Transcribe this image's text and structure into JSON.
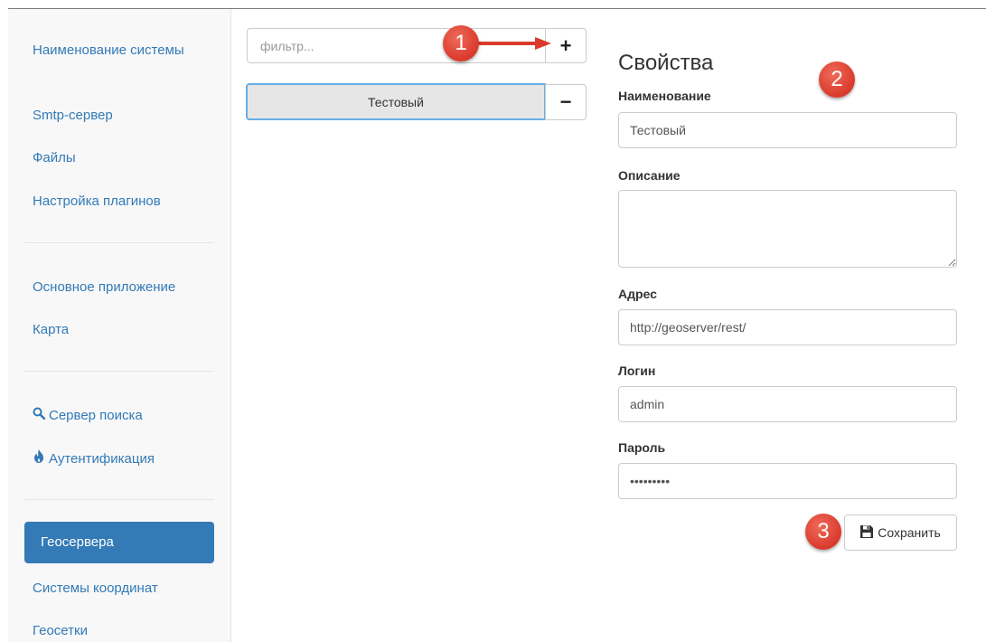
{
  "sidebar": {
    "items": [
      {
        "label": "Наименование системы",
        "icon": "",
        "active": false
      },
      {
        "label": "Smtp-сервер",
        "icon": "",
        "active": false
      },
      {
        "label": "Файлы",
        "icon": "",
        "active": false
      },
      {
        "label": "Настройка плагинов",
        "icon": "",
        "active": false
      },
      {
        "label": "Основное приложение",
        "icon": "",
        "active": false
      },
      {
        "label": "Карта",
        "icon": "",
        "active": false
      },
      {
        "label": "Сервер поиска",
        "icon": "search-icon",
        "active": false
      },
      {
        "label": "Аутентификация",
        "icon": "fire-icon",
        "active": false
      },
      {
        "label": "Геосервера",
        "icon": "",
        "active": true
      },
      {
        "label": "Системы координат",
        "icon": "",
        "active": false
      },
      {
        "label": "Геосетки",
        "icon": "",
        "active": false
      }
    ]
  },
  "list": {
    "filter_placeholder": "фильтр...",
    "add_label": "+",
    "remove_label": "−",
    "items": [
      {
        "label": "Тестовый",
        "selected": true
      }
    ]
  },
  "properties": {
    "title": "Свойства",
    "name_label": "Наименование",
    "name_value": "Тестовый",
    "description_label": "Описание",
    "description_value": "",
    "address_label": "Адрес",
    "address_value": "http://geoserver/rest/",
    "login_label": "Логин",
    "login_value": "admin",
    "password_label": "Пароль",
    "password_value": "secretpwd",
    "save_label": "Сохранить",
    "save_icon": "floppy-disk-icon"
  },
  "annotations": {
    "badge1": "1",
    "badge2": "2",
    "badge3": "3",
    "badge_color": "#d93a2b"
  },
  "colors": {
    "accent": "#337ab7",
    "sidebar_bg": "#f8f8f8",
    "focus_border": "#66afe9"
  }
}
